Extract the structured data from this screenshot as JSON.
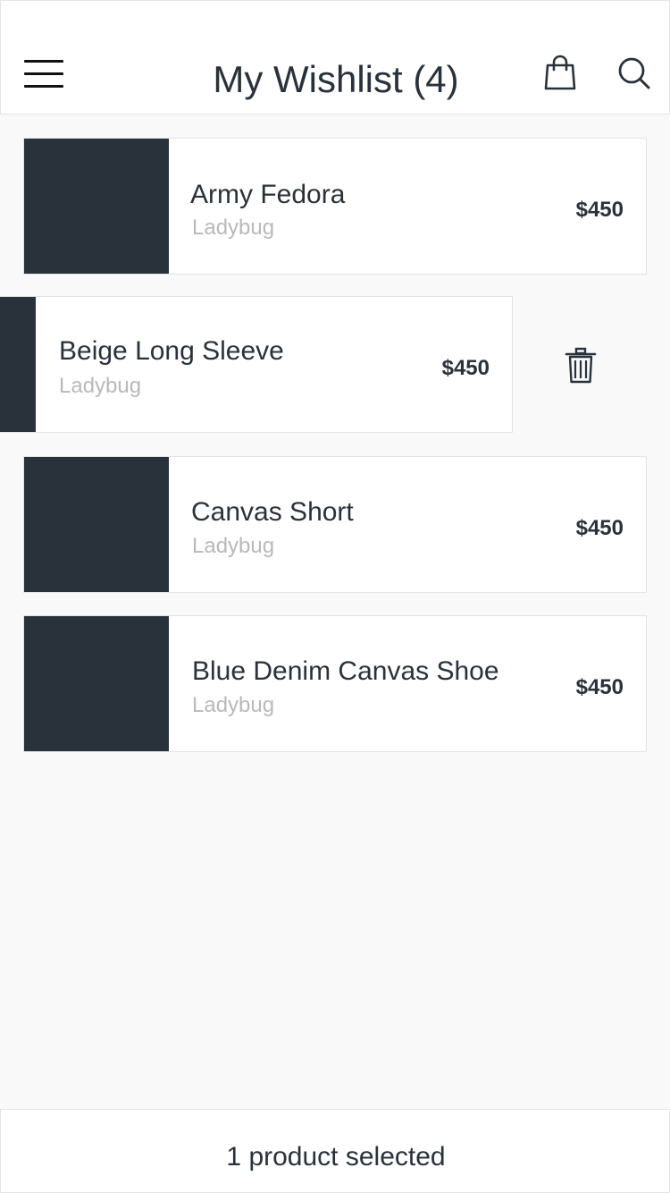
{
  "header": {
    "title": "My Wishlist (4)",
    "menu_icon": "hamburger-menu-icon",
    "bag_icon": "shopping-bag-icon",
    "search_icon": "search-icon"
  },
  "wishlist": {
    "items": [
      {
        "name": "Army Fedora",
        "brand": "Ladybug",
        "price": "$450"
      },
      {
        "name": "Beige Long Sleeve",
        "brand": "Ladybug",
        "price": "$450",
        "swiped": true,
        "action_icon": "trash-icon"
      },
      {
        "name": "Canvas Short",
        "brand": "Ladybug",
        "price": "$450"
      },
      {
        "name": "Blue Denim Canvas Shoe",
        "brand": "Ladybug",
        "price": "$450"
      }
    ]
  },
  "footer": {
    "status": "1 product selected"
  },
  "colors": {
    "dark": "#29323a",
    "muted": "#b9b9b9",
    "background": "#f9f9f9",
    "card": "#ffffff",
    "border": "#e3e3e3"
  }
}
